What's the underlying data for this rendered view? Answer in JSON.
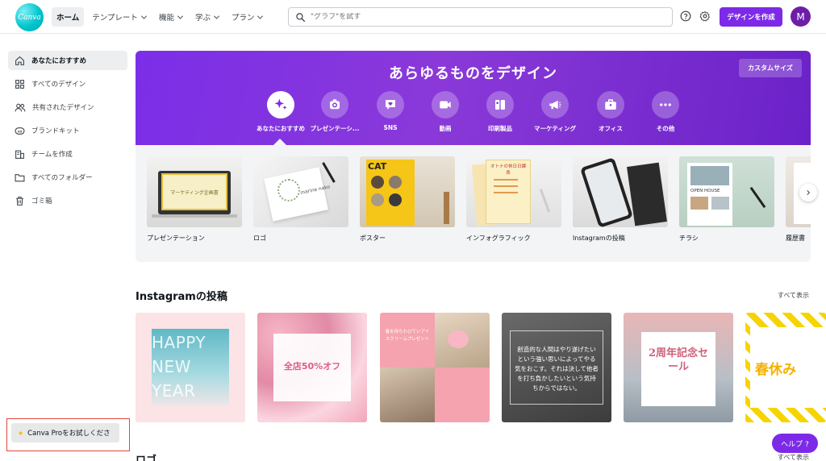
{
  "header": {
    "logo_text": "Canva",
    "nav": [
      {
        "label": "ホーム",
        "dropdown": false,
        "active": true
      },
      {
        "label": "テンプレート",
        "dropdown": true
      },
      {
        "label": "機能",
        "dropdown": true
      },
      {
        "label": "学ぶ",
        "dropdown": true
      },
      {
        "label": "プラン",
        "dropdown": true
      }
    ],
    "search_placeholder": "\"グラフ\"を試す",
    "create_button": "デザインを作成",
    "avatar_initial": "M",
    "brand_color": "#7d2ae8"
  },
  "sidebar": {
    "items": [
      {
        "label": "あなたにおすすめ",
        "icon": "home-icon"
      },
      {
        "label": "すべてのデザイン",
        "icon": "grid-icon"
      },
      {
        "label": "共有されたデザイン",
        "icon": "people-icon"
      },
      {
        "label": "ブランドキット",
        "icon": "brand-kit-icon"
      },
      {
        "label": "チームを作成",
        "icon": "team-icon"
      },
      {
        "label": "すべてのフォルダー",
        "icon": "folder-icon"
      },
      {
        "label": "ゴミ箱",
        "icon": "trash-icon"
      }
    ],
    "pro_button": "Canva Proをお試しくださ"
  },
  "hero": {
    "title": "あらゆるものをデザイン",
    "custom_size": "カスタムサイズ",
    "categories": [
      {
        "label": "あなたにおすすめ",
        "icon": "sparkle-icon"
      },
      {
        "label": "プレゼンテーシ...",
        "icon": "presentation-icon"
      },
      {
        "label": "SNS",
        "icon": "heart-chat-icon"
      },
      {
        "label": "動画",
        "icon": "video-icon"
      },
      {
        "label": "印刷製品",
        "icon": "print-icon"
      },
      {
        "label": "マーケティング",
        "icon": "megaphone-icon"
      },
      {
        "label": "オフィス",
        "icon": "briefcase-icon"
      },
      {
        "label": "その他",
        "icon": "more-icon"
      }
    ]
  },
  "templates": [
    {
      "label": "プレゼンテーション",
      "thumb_text": "マーケティング企画書"
    },
    {
      "label": "ロゴ",
      "thumb_text": "marine nako"
    },
    {
      "label": "ポスター",
      "thumb_text": "CAT"
    },
    {
      "label": "インフォグラフィック",
      "thumb_text": "オトナの休日日課表"
    },
    {
      "label": "Instagramの投稿",
      "thumb_text": ""
    },
    {
      "label": "チラシ",
      "thumb_text": "OPEN HOUSE"
    },
    {
      "label": "履歴書",
      "thumb_text": ""
    }
  ],
  "instagram": {
    "title": "Instagramの投稿",
    "see_all": "すべて表示",
    "posts": [
      {
        "text": "HAPPY NEW YEAR"
      },
      {
        "text": "全店50%オフ"
      },
      {
        "text": "春を待ちわびていアイスクリームプレゼント"
      },
      {
        "text": "創造的な人間はやり遂げたいという強い思いによってやる気をおこす。それは決して他者を打ち負かしたいという気持ちからではない。"
      },
      {
        "text": "2周年記念セール"
      },
      {
        "text": "春休み"
      }
    ]
  },
  "logo_section": {
    "title": "ロゴ",
    "see_all": "すべて表示"
  },
  "help_button": "ヘルプ ?"
}
